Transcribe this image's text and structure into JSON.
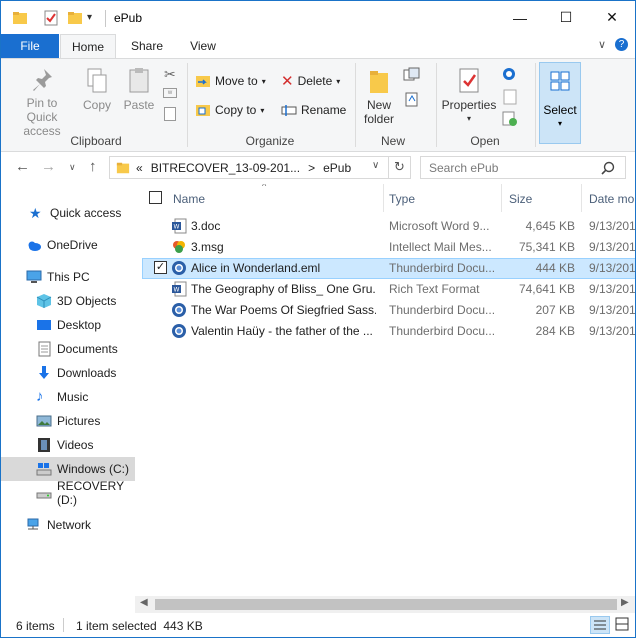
{
  "window": {
    "title": "ePub"
  },
  "title_buttons": {
    "minimize": "—",
    "maximize": "☐",
    "close": "✕"
  },
  "tabs": {
    "file": "File",
    "home": "Home",
    "share": "Share",
    "view": "View"
  },
  "ribbon": {
    "clipboard": {
      "pin": "Pin to Quick access",
      "copy": "Copy",
      "paste": "Paste",
      "label": "Clipboard"
    },
    "organize": {
      "move_to": "Move to",
      "delete": "Delete",
      "copy_to": "Copy to",
      "rename": "Rename",
      "label": "Organize"
    },
    "new": {
      "new_folder": "New folder",
      "label": "New"
    },
    "open": {
      "properties": "Properties",
      "label": "Open"
    },
    "select": {
      "label": "Select"
    }
  },
  "address": {
    "prefix": "«",
    "crumbs": [
      "BITRECOVER_13-09-201...",
      "ePub"
    ],
    "separator": ">",
    "search_placeholder": "Search ePub"
  },
  "nav": {
    "items": [
      {
        "label": "Quick access",
        "icon": "star-icon"
      },
      {
        "label": "OneDrive",
        "icon": "cloud-icon"
      },
      {
        "label": "This PC",
        "icon": "computer-icon"
      },
      {
        "label": "3D Objects",
        "icon": "cube-icon"
      },
      {
        "label": "Desktop",
        "icon": "desktop-icon"
      },
      {
        "label": "Documents",
        "icon": "document-icon"
      },
      {
        "label": "Downloads",
        "icon": "download-icon"
      },
      {
        "label": "Music",
        "icon": "music-icon"
      },
      {
        "label": "Pictures",
        "icon": "picture-icon"
      },
      {
        "label": "Videos",
        "icon": "video-icon"
      },
      {
        "label": "Windows (C:)",
        "icon": "drive-icon"
      },
      {
        "label": "RECOVERY (D:)",
        "icon": "drive-icon"
      },
      {
        "label": "Network",
        "icon": "network-icon"
      }
    ]
  },
  "list": {
    "columns": {
      "name": "Name",
      "type": "Type",
      "size": "Size",
      "date": "Date mo"
    },
    "rows": [
      {
        "name": "3.doc",
        "type": "Microsoft Word 9...",
        "size": "4,645 KB",
        "date": "9/13/201",
        "icon": "word-icon"
      },
      {
        "name": "3.msg",
        "type": "Intellect Mail Mes...",
        "size": "75,341 KB",
        "date": "9/13/201",
        "icon": "msg-icon"
      },
      {
        "name": "Alice in Wonderland.eml",
        "type": "Thunderbird Docu...",
        "size": "444 KB",
        "date": "9/13/201",
        "icon": "thunderbird-icon"
      },
      {
        "name": "The Geography of Bliss_ One Gru...",
        "type": "Rich Text Format",
        "size": "74,641 KB",
        "date": "9/13/201",
        "icon": "word-icon"
      },
      {
        "name": "The War Poems Of Siegfried Sass...",
        "type": "Thunderbird Docu...",
        "size": "207 KB",
        "date": "9/13/201",
        "icon": "thunderbird-icon"
      },
      {
        "name": "Valentin Haüy - the father of the ...",
        "type": "Thunderbird Docu...",
        "size": "284 KB",
        "date": "9/13/201",
        "icon": "thunderbird-icon"
      }
    ],
    "selected_index": 2
  },
  "status": {
    "count": "6 items",
    "selection": "1 item selected  443 KB"
  },
  "colors": {
    "accent": "#1a6fd0",
    "selection": "#cce8ff",
    "selection_border": "#99d1ff"
  }
}
